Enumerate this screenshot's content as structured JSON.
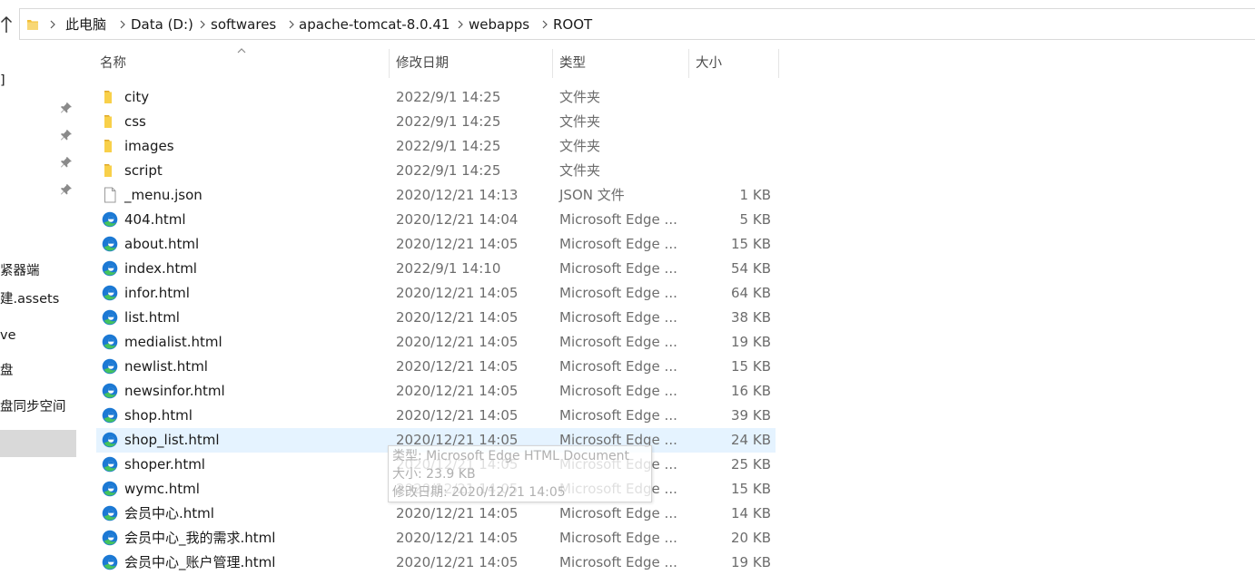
{
  "address": {
    "crumbs": [
      "此电脑",
      "Data (D:)",
      "softwares",
      "apache-tomcat-8.0.41",
      "webapps",
      "ROOT"
    ]
  },
  "nav_pane": {
    "items": [
      "]",
      "紧器端",
      "建.assets",
      "ve",
      "盘",
      "盘同步空间"
    ]
  },
  "columns": {
    "name": "名称",
    "date": "修改日期",
    "type": "类型",
    "size": "大小"
  },
  "files": [
    {
      "name": "city",
      "date": "2022/9/1 14:25",
      "type": "文件夹",
      "size": "",
      "icon": "folder-icon"
    },
    {
      "name": "css",
      "date": "2022/9/1 14:25",
      "type": "文件夹",
      "size": "",
      "icon": "folder-icon"
    },
    {
      "name": "images",
      "date": "2022/9/1 14:25",
      "type": "文件夹",
      "size": "",
      "icon": "folder-icon"
    },
    {
      "name": "script",
      "date": "2022/9/1 14:25",
      "type": "文件夹",
      "size": "",
      "icon": "folder-icon"
    },
    {
      "name": "_menu.json",
      "date": "2020/12/21 14:13",
      "type": "JSON 文件",
      "size": "1 KB",
      "icon": "file-icon"
    },
    {
      "name": "404.html",
      "date": "2020/12/21 14:04",
      "type": "Microsoft Edge ...",
      "size": "5 KB",
      "icon": "edge-icon"
    },
    {
      "name": "about.html",
      "date": "2020/12/21 14:05",
      "type": "Microsoft Edge ...",
      "size": "15 KB",
      "icon": "edge-icon"
    },
    {
      "name": "index.html",
      "date": "2022/9/1 14:10",
      "type": "Microsoft Edge ...",
      "size": "54 KB",
      "icon": "edge-icon"
    },
    {
      "name": "infor.html",
      "date": "2020/12/21 14:05",
      "type": "Microsoft Edge ...",
      "size": "64 KB",
      "icon": "edge-icon"
    },
    {
      "name": "list.html",
      "date": "2020/12/21 14:05",
      "type": "Microsoft Edge ...",
      "size": "38 KB",
      "icon": "edge-icon"
    },
    {
      "name": "medialist.html",
      "date": "2020/12/21 14:05",
      "type": "Microsoft Edge ...",
      "size": "19 KB",
      "icon": "edge-icon"
    },
    {
      "name": "newlist.html",
      "date": "2020/12/21 14:05",
      "type": "Microsoft Edge ...",
      "size": "15 KB",
      "icon": "edge-icon"
    },
    {
      "name": "newsinfor.html",
      "date": "2020/12/21 14:05",
      "type": "Microsoft Edge ...",
      "size": "16 KB",
      "icon": "edge-icon"
    },
    {
      "name": "shop.html",
      "date": "2020/12/21 14:05",
      "type": "Microsoft Edge ...",
      "size": "39 KB",
      "icon": "edge-icon"
    },
    {
      "name": "shop_list.html",
      "date": "2020/12/21 14:05",
      "type": "Microsoft Edge ...",
      "size": "24 KB",
      "icon": "edge-icon",
      "selected": true
    },
    {
      "name": "shoper.html",
      "date": "2020/12/21 14:05",
      "type": "Microsoft Edge ...",
      "size": "25 KB",
      "icon": "edge-icon"
    },
    {
      "name": "wymc.html",
      "date": "2020/12/21 14:05",
      "type": "Microsoft Edge ...",
      "size": "15 KB",
      "icon": "edge-icon"
    },
    {
      "name": "会员中心.html",
      "date": "2020/12/21 14:05",
      "type": "Microsoft Edge ...",
      "size": "14 KB",
      "icon": "edge-icon"
    },
    {
      "name": "会员中心_我的需求.html",
      "date": "2020/12/21 14:05",
      "type": "Microsoft Edge ...",
      "size": "20 KB",
      "icon": "edge-icon"
    },
    {
      "name": "会员中心_账户管理.html",
      "date": "2020/12/21 14:05",
      "type": "Microsoft Edge ...",
      "size": "19 KB",
      "icon": "edge-icon"
    }
  ],
  "tooltip": {
    "type_line": "类型: Microsoft Edge HTML Document",
    "size_line": "大小: 23.9 KB",
    "date_line": "修改日期: 2020/12/21 14:05"
  }
}
